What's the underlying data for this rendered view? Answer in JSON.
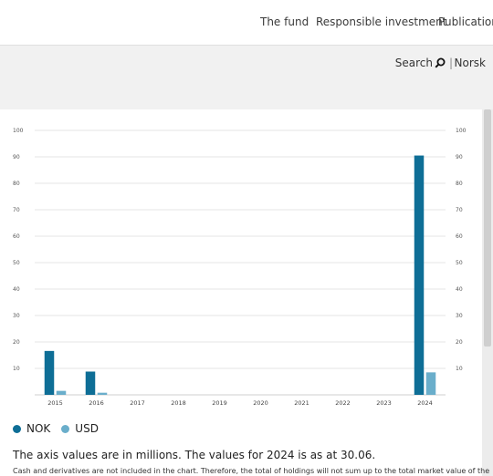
{
  "nav": {
    "items": [
      "The fund",
      "Responsible investment",
      "Publications"
    ]
  },
  "subbar": {
    "search_label": "Search",
    "separator": "|",
    "language": "Norsk"
  },
  "chart_data": {
    "type": "bar",
    "categories": [
      "2015",
      "2016",
      "2017",
      "2018",
      "2019",
      "2020",
      "2021",
      "2022",
      "2023",
      "2024"
    ],
    "series": [
      {
        "name": "NOK",
        "color": "#0e6e96",
        "values": [
          16.6,
          8.8,
          0,
          0,
          0,
          0,
          0,
          0,
          0,
          90.5
        ]
      },
      {
        "name": "USD",
        "color": "#6aaecb",
        "values": [
          1.5,
          0.8,
          0,
          0,
          0,
          0,
          0,
          0,
          0,
          8.5
        ]
      }
    ],
    "yticks": [
      10,
      20,
      30,
      40,
      50,
      60,
      70,
      80,
      90,
      100
    ],
    "ylim": [
      0,
      100
    ],
    "grid": true,
    "legend_position": "bottom-left"
  },
  "legend": {
    "nok": "NOK",
    "usd": "USD",
    "nok_color": "#0e6e96",
    "usd_color": "#6aaecb"
  },
  "notes": {
    "axis_note": "The axis values are in millions. The values for 2024 is as at 30.06.",
    "detail": "Cash and derivatives are not included in the chart. Therefore, the total of holdings will not sum up to the total market value of the"
  }
}
